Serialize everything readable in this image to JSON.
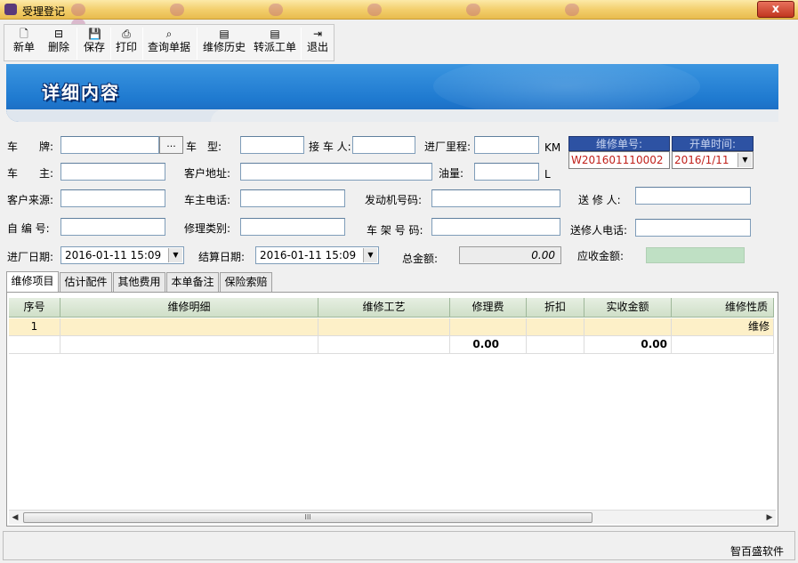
{
  "window": {
    "title": "受理登记",
    "close_label": "x"
  },
  "toolbar": {
    "items": [
      {
        "label": "新单",
        "icon": "new-doc-icon",
        "glyph": "🗋"
      },
      {
        "label": "删除",
        "icon": "delete-icon",
        "glyph": "⊟"
      },
      {
        "label": "保存",
        "icon": "save-icon",
        "glyph": "💾"
      },
      {
        "label": "打印",
        "icon": "print-icon",
        "glyph": "⎙"
      },
      {
        "label": "查询单据",
        "icon": "binoculars-icon",
        "glyph": "⌕"
      },
      {
        "label": "维修历史",
        "icon": "history-icon",
        "glyph": "▤"
      },
      {
        "label": "转派工单",
        "icon": "transfer-icon",
        "glyph": "▤"
      },
      {
        "label": "退出",
        "icon": "exit-icon",
        "glyph": "⇥"
      }
    ]
  },
  "banner": {
    "title": "详细内容"
  },
  "form": {
    "plate_label": "车　　牌:",
    "plate_dots": "...",
    "model_label": "车　型:",
    "receiver_label": "接 车 人:",
    "mileage_label": "进厂里程:",
    "mileage_unit": "KM",
    "owner_label": "车　　主:",
    "address_label": "客户地址:",
    "fuel_label": "油量:",
    "fuel_unit": "L",
    "source_label": "客户来源:",
    "phone_label": "车主电话:",
    "engine_label": "发动机号码:",
    "sender_label": "送 修 人:",
    "selfno_label": "自 编 号:",
    "repairtype_label": "修理类别:",
    "frame_label": "车 架 号 码:",
    "sender_phone_label": "送修人电话:",
    "entry_date_label": "进厂日期:",
    "entry_date_value": "2016-01-11 15:09",
    "settle_date_label": "结算日期:",
    "settle_date_value": "2016-01-11 15:09",
    "total_label": "总金额:",
    "total_value": "0.00",
    "receivable_label": "应收金额:",
    "order_no_header": "维修单号:",
    "order_no_value": "W201601110002",
    "open_time_header": "开单时间:",
    "open_time_value": "2016/1/11"
  },
  "tabs": [
    "维修项目",
    "估计配件",
    "其他费用",
    "本单备注",
    "保险索赔"
  ],
  "grid": {
    "columns": [
      "序号",
      "维修明细",
      "维修工艺",
      "修理费",
      "折扣",
      "实收金额",
      "维修性质"
    ],
    "rows": [
      [
        "1",
        "",
        "",
        "",
        "",
        "",
        "维修"
      ]
    ],
    "totals": {
      "repair_fee": "0.00",
      "actual_amount": "0.00"
    },
    "scroll_grip": "III"
  },
  "status": {
    "company": "智百盛软件"
  },
  "colors": {
    "banner": "#1f7ad0",
    "header_box": "#2d52a3",
    "order_red": "#c0201a",
    "row_highlight": "#fdf0c8",
    "receivable_green": "#bfe0c4"
  }
}
